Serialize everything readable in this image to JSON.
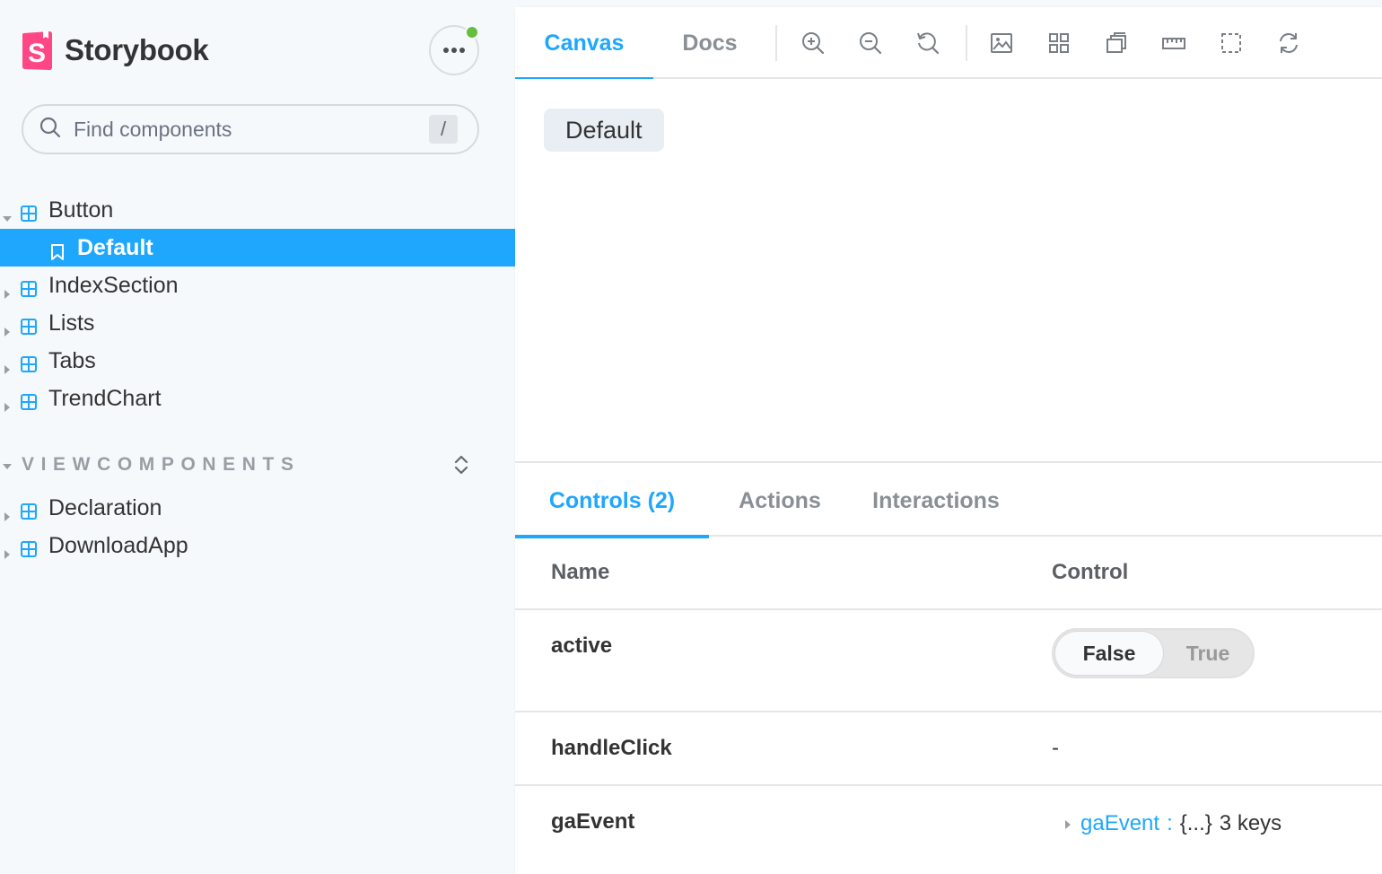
{
  "sidebar": {
    "brand_name": "Storybook",
    "search": {
      "placeholder": "Find components",
      "shortcut": "/"
    },
    "tree": [
      {
        "label": "Button",
        "expanded": true
      },
      {
        "label": "Default",
        "type": "story",
        "selected": true
      },
      {
        "label": "IndexSection"
      },
      {
        "label": "Lists"
      },
      {
        "label": "Tabs"
      },
      {
        "label": "TrendChart"
      }
    ],
    "section": {
      "label": "VIEWCOMPONENTS",
      "items": [
        {
          "label": "Declaration"
        },
        {
          "label": "DownloadApp"
        }
      ]
    }
  },
  "toolbar": {
    "tabs": [
      {
        "label": "Canvas",
        "active": true
      },
      {
        "label": "Docs",
        "active": false
      }
    ],
    "tools": [
      "zoom-in-icon",
      "zoom-out-icon",
      "zoom-reset-icon",
      "background-icon",
      "grid-icon",
      "viewport-icon",
      "measure-icon",
      "outline-icon",
      "remount-icon"
    ]
  },
  "canvas": {
    "button_label": "Default"
  },
  "addons": {
    "tabs": [
      {
        "label": "Controls (2)",
        "active": true
      },
      {
        "label": "Actions",
        "active": false
      },
      {
        "label": "Interactions",
        "active": false
      }
    ],
    "table": {
      "headers": {
        "name": "Name",
        "control": "Control"
      },
      "rows": [
        {
          "name": "active",
          "control": {
            "type": "boolean",
            "false_label": "False",
            "true_label": "True",
            "value": false
          }
        },
        {
          "name": "handleClick",
          "control": {
            "type": "none",
            "text": "-"
          }
        },
        {
          "name": "gaEvent",
          "control": {
            "type": "object",
            "key": "gaEvent",
            "separator": ":",
            "value": "{...}",
            "count": "3 keys"
          }
        }
      ]
    }
  },
  "colors": {
    "accent": "#1ea7fd",
    "sidebar_bg": "#f6f9fc",
    "status_online": "#66bf3c",
    "brand_pink": "#ff4785"
  }
}
